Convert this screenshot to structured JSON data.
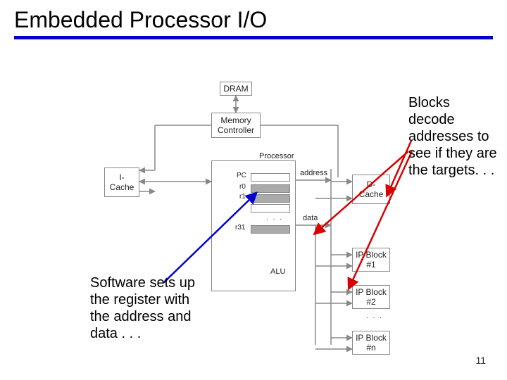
{
  "title": "Embedded Processor I/O",
  "blocks": {
    "dram": "DRAM",
    "memctrl": "Memory\nController",
    "icache": "I-Cache",
    "processor": "Processor",
    "alu": "ALU",
    "dcache": "D-Cache",
    "ip1": "IP Block\n#1",
    "ip2": "IP Block\n#2",
    "ipn": "IP Block\n#n"
  },
  "labels": {
    "pc": "PC",
    "r0": "r0",
    "r1": "r1",
    "r31": "r31",
    "address": "address",
    "data": "data"
  },
  "dots": {
    "regs": ". . .",
    "ip": ". . ."
  },
  "annotations": {
    "right": "Blocks decode addresses to see if they are the targets. . .",
    "left": "Software sets up the register with the address and data . . ."
  },
  "page": "11"
}
